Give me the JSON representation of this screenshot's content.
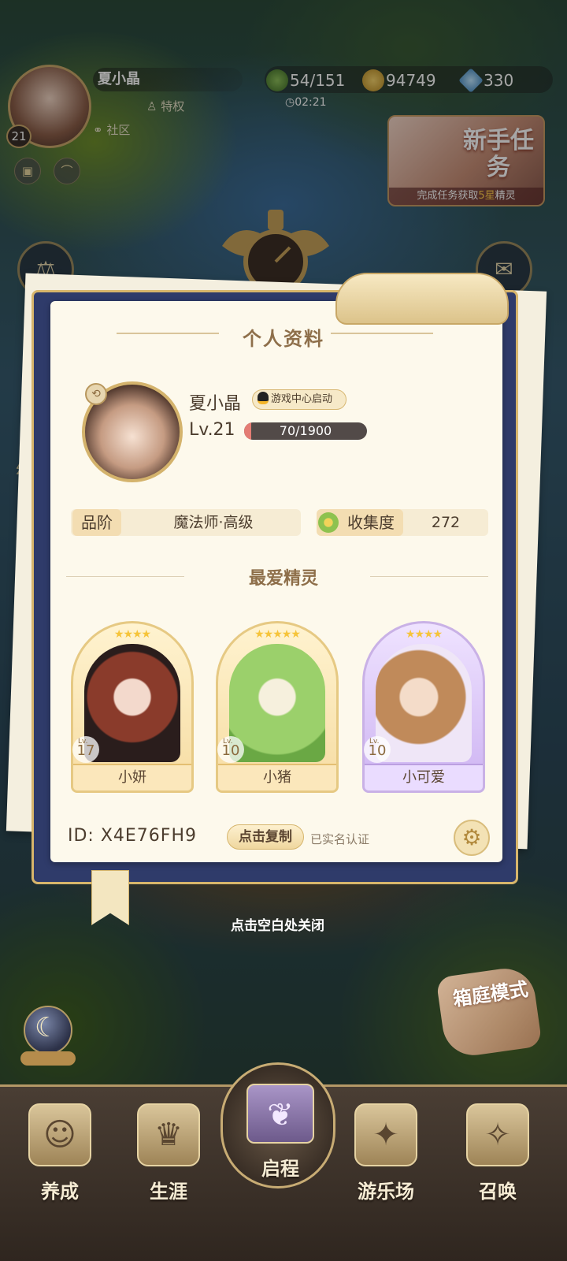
{
  "hud": {
    "name": "夏小晶",
    "avatar_level": "21",
    "privilege": "特权",
    "community": "社区",
    "resources": {
      "stamina": "54/151",
      "coins": "94749",
      "crystals": "330"
    },
    "timer": "02:21"
  },
  "newbie_task": {
    "title": "新手任务",
    "subtitle_prefix": "完成任务获取",
    "subtitle_highlight": "5星",
    "subtitle_suffix": "精灵"
  },
  "side_left_fragment": "幻",
  "profile": {
    "title": "个人资料",
    "name": "夏小晶",
    "launch_badge": "游戏中心启动",
    "level": "Lv.21",
    "exp_text": "70/1900",
    "exp_fraction": 0.037,
    "rank_label": "品阶",
    "rank_value": "魔法师·高级",
    "collection_label": "收集度",
    "collection_value": "272",
    "favorite_title": "最爱精灵",
    "spirits": [
      {
        "name": "小妍",
        "level": "17",
        "stars": "★★★★",
        "theme": "gold"
      },
      {
        "name": "小猪",
        "level": "10",
        "stars": "★★★★★",
        "theme": "gold"
      },
      {
        "name": "小可爱",
        "level": "10",
        "stars": "★★★★",
        "theme": "purple"
      }
    ],
    "lv_prefix": "Lv.",
    "id_text": "ID: X4E76FH9",
    "copy_button": "点击复制",
    "verified": "已实名认证"
  },
  "close_hint": "点击空白处关闭",
  "garden_mode": "箱庭模式",
  "nav": {
    "items": [
      {
        "label": "养成",
        "icon": "girl-face-icon"
      },
      {
        "label": "生涯",
        "icon": "crown-icon"
      },
      {
        "label": "启程",
        "icon": "book-butterfly-icon"
      },
      {
        "label": "游乐场",
        "icon": "star-badge-icon"
      },
      {
        "label": "召唤",
        "icon": "card-star-icon"
      }
    ]
  }
}
